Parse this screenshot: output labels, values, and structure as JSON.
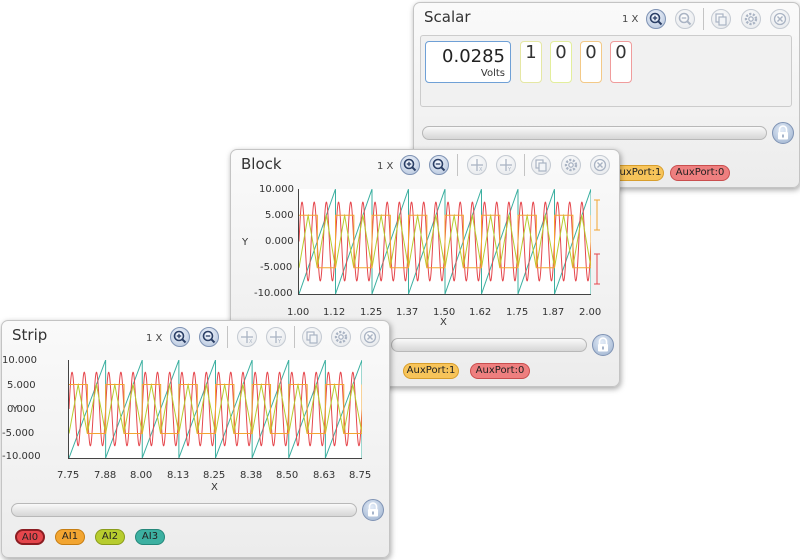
{
  "colors": {
    "ai0": "#e5464c",
    "ai1": "#f2a531",
    "ai2": "#b7cc2e",
    "ai3": "#3cb0a1",
    "aux1": "#f7c45a",
    "aux0": "#ee7f7f"
  },
  "icons": {
    "zoom_in": "zoom-in-icon",
    "zoom_out": "zoom-out-icon",
    "cursor_x": "cursor-x-icon",
    "cursor_y": "cursor-y-icon",
    "copy": "copy-icon",
    "settings": "gear-icon",
    "close": "close-icon",
    "lock": "lock-icon"
  },
  "scalar": {
    "title": "Scalar",
    "zoom_factor": "1 X",
    "value": "0.0285",
    "unit": "Volts",
    "digits": [
      "1",
      "0",
      "0",
      "0"
    ],
    "chips": [
      "AuxPort:1",
      "AuxPort:0"
    ]
  },
  "block": {
    "title": "Block",
    "zoom_factor": "1 X",
    "y_label": "Y",
    "x_label": "X",
    "chips": [
      "AuxPort:1",
      "AuxPort:0"
    ]
  },
  "strip": {
    "title": "Strip",
    "zoom_factor": "1 X",
    "y_label": "Y",
    "x_label": "X",
    "chips": [
      "AI0",
      "AI1",
      "AI2",
      "AI3"
    ]
  },
  "chart_data": [
    {
      "type": "line",
      "chart": "block",
      "x_range": [
        1.0,
        2.0
      ],
      "ylim": [
        -10.0,
        10.0
      ],
      "x_tick_labels": [
        "1.00",
        "1.12",
        "1.25",
        "1.37",
        "1.50",
        "1.62",
        "1.75",
        "1.87",
        "2.00"
      ],
      "y_tick_labels": [
        "10.000",
        "5.000",
        "0.000",
        "-5.000",
        "-10.000"
      ],
      "xlabel": "X",
      "ylabel": "Y",
      "grid": false,
      "series": [
        {
          "name": "AI0",
          "shape": "sine",
          "amplitude": 7.5,
          "cycles": 24,
          "color": "#e5464c"
        },
        {
          "name": "AI1",
          "shape": "square",
          "amplitude": 5,
          "cycles": 8,
          "color": "#f2a531"
        },
        {
          "name": "AI2",
          "shape": "triangle",
          "amplitude": 5,
          "cycles": 16,
          "color": "#b7cc2e"
        },
        {
          "name": "AI3",
          "shape": "sawtooth",
          "amplitude": 10,
          "cycles": 8,
          "color": "#3cb0a1"
        }
      ]
    },
    {
      "type": "line",
      "chart": "strip",
      "x_range": [
        7.75,
        8.75
      ],
      "ylim": [
        -10.0,
        10.0
      ],
      "x_tick_labels": [
        "7.75",
        "7.88",
        "8.00",
        "8.13",
        "8.25",
        "8.38",
        "8.50",
        "8.63",
        "8.75"
      ],
      "y_tick_labels": [
        "10.000",
        "5.000",
        "0.000",
        "-5.000",
        "-10.000"
      ],
      "xlabel": "X",
      "ylabel": "Y",
      "grid": false,
      "series": [
        {
          "name": "AI0",
          "shape": "sine",
          "amplitude": 7.5,
          "cycles": 24,
          "color": "#e5464c"
        },
        {
          "name": "AI1",
          "shape": "square",
          "amplitude": 5,
          "cycles": 8,
          "color": "#f2a531"
        },
        {
          "name": "AI2",
          "shape": "triangle",
          "amplitude": 5,
          "cycles": 16,
          "color": "#b7cc2e"
        },
        {
          "name": "AI3",
          "shape": "sawtooth",
          "amplitude": 10,
          "cycles": 8,
          "color": "#3cb0a1"
        }
      ]
    }
  ]
}
